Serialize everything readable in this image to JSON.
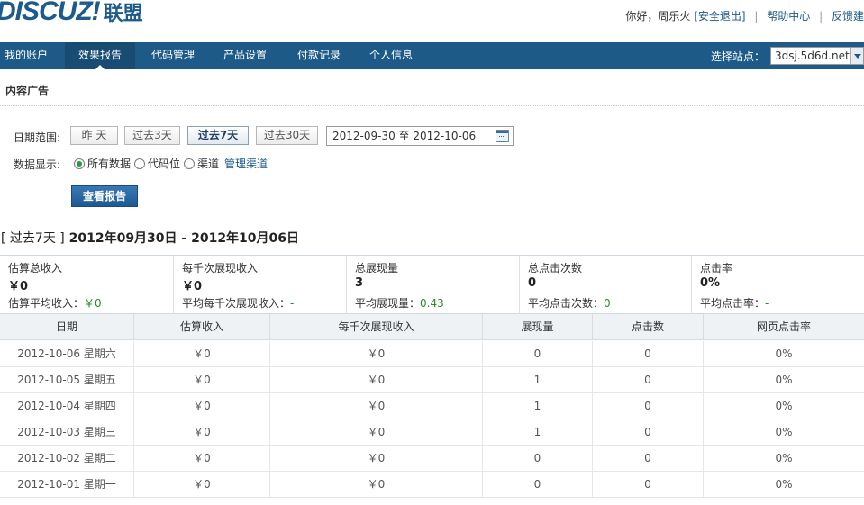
{
  "header": {
    "logo_mark": "DISCUZ!",
    "logo_sub": "联盟",
    "greeting": "你好，周乐火",
    "logout": "[安全退出]",
    "help": "帮助中心",
    "feedback": "反馈建"
  },
  "nav": {
    "items": [
      "我的账户",
      "效果报告",
      "代码管理",
      "产品设置",
      "付款记录",
      "个人信息"
    ],
    "active_index": 1,
    "site_label": "选择站点：",
    "site_value": "3dsj.5d6d.net"
  },
  "section_title": "内容广告",
  "filter": {
    "date_label": "日期范围:",
    "ranges": [
      "昨 天",
      "过去3天",
      "过去7天",
      "过去30天"
    ],
    "active_range": 2,
    "date_value": "2012-09-30 至  2012-10-06",
    "display_label": "数据显示:",
    "options": [
      "所有数据",
      "代码位",
      "渠道"
    ],
    "checked_option": 0,
    "manage_link": "管理渠道",
    "submit": "查看报告"
  },
  "report_title": {
    "range": "[ 过去7天 ]",
    "period": "2012年09月30日 - 2012年10月06日"
  },
  "summary": [
    {
      "label": "估算总收入",
      "value": "￥0",
      "avg_label": "估算平均收入：",
      "avg_value": "￥0"
    },
    {
      "label": "每千次展现收入",
      "value": "￥0",
      "avg_label": "平均每千次展现收入：",
      "avg_value": "-"
    },
    {
      "label": "总展现量",
      "value": "3",
      "avg_label": "平均展现量：",
      "avg_value": "0.43"
    },
    {
      "label": "总点击次数",
      "value": "0",
      "avg_label": "平均点击次数：",
      "avg_value": "0"
    },
    {
      "label": "点击率",
      "value": "0%",
      "avg_label": "平均点击率：",
      "avg_value": "-"
    }
  ],
  "table": {
    "headers": [
      "日期",
      "估算收入",
      "每千次展现收入",
      "展现量",
      "点击数",
      "网页点击率"
    ],
    "rows": [
      [
        "2012-10-06 星期六",
        "￥0",
        "￥0",
        "0",
        "0",
        "0%"
      ],
      [
        "2012-10-05 星期五",
        "￥0",
        "￥0",
        "1",
        "0",
        "0%"
      ],
      [
        "2012-10-04 星期四",
        "￥0",
        "￥0",
        "1",
        "0",
        "0%"
      ],
      [
        "2012-10-03 星期三",
        "￥0",
        "￥0",
        "1",
        "0",
        "0%"
      ],
      [
        "2012-10-02 星期二",
        "￥0",
        "￥0",
        "0",
        "0",
        "0%"
      ],
      [
        "2012-10-01 星期一",
        "￥0",
        "￥0",
        "0",
        "0",
        "0%"
      ]
    ]
  },
  "colors": {
    "nav_bg": "#1d5a88",
    "link": "#1e5a8c",
    "positive": "#2a8a2a"
  }
}
